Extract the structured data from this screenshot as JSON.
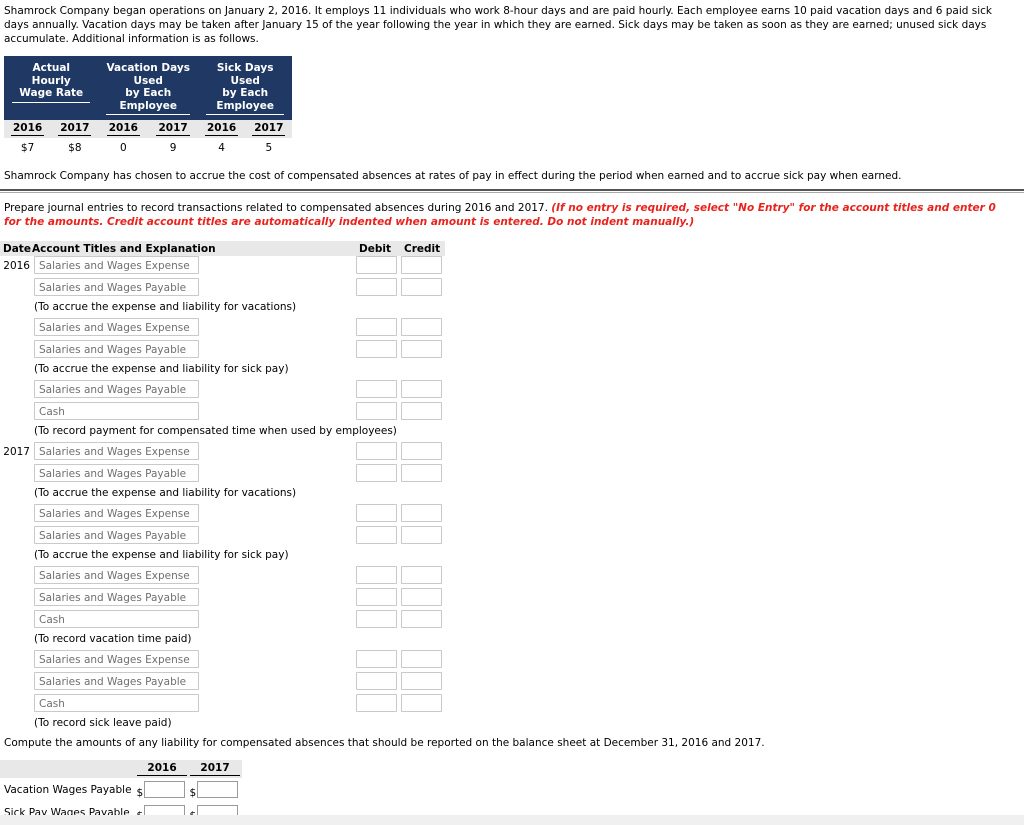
{
  "intro": {
    "paragraph": "Shamrock Company began operations on January 2, 2016. It employs 11 individuals who work 8-hour days and are paid hourly. Each employee earns 10 paid vacation days and 6 paid sick days annually. Vacation days may be taken after January 15 of the year following the year in which they are earned. Sick days may be taken as soon as they are earned; unused sick days accumulate. Additional information is as follows."
  },
  "fact_table": {
    "group_headers": [
      "Actual Hourly Wage Rate",
      "Vacation Days Used by Each Employee",
      "Sick Days Used by Each Employee"
    ],
    "group_header_lines": [
      [
        "Actual",
        "Hourly",
        "Wage Rate"
      ],
      [
        "Vacation Days",
        "Used",
        "by Each",
        "Employee"
      ],
      [
        "Sick Days",
        "Used",
        "by Each",
        "Employee"
      ]
    ],
    "year_headers": [
      "2016",
      "2017",
      "2016",
      "2017",
      "2016",
      "2017"
    ],
    "values": [
      "$7",
      "$8",
      "0",
      "9",
      "4",
      "5"
    ]
  },
  "accrual_note": "Shamrock Company has chosen to accrue the cost of compensated absences at rates of pay in effect during the period when earned and to accrue sick pay when earned.",
  "prompt": {
    "main": "Prepare journal entries to record transactions related to compensated absences during 2016 and 2017. ",
    "italic": "(If no entry is required, select \"No Entry\" for the account titles and enter 0 for the amounts. Credit account titles are automatically indented when amount is entered. Do not indent manually.)"
  },
  "journal": {
    "headers": {
      "date": "Date",
      "account": "Account Titles and Explanation",
      "debit": "Debit",
      "credit": "Credit"
    },
    "rows": [
      {
        "type": "entry",
        "year": "2016",
        "account": "Salaries and Wages Expense"
      },
      {
        "type": "entry",
        "year": "",
        "account": "Salaries and Wages Payable"
      },
      {
        "type": "memo",
        "text": "(To accrue the expense and liability for vacations)"
      },
      {
        "type": "entry",
        "year": "",
        "account": "Salaries and Wages Expense"
      },
      {
        "type": "entry",
        "year": "",
        "account": "Salaries and Wages Payable"
      },
      {
        "type": "memo",
        "text": "(To accrue the expense and liability for sick pay)"
      },
      {
        "type": "entry",
        "year": "",
        "account": "Salaries and Wages Payable"
      },
      {
        "type": "entry",
        "year": "",
        "account": "Cash"
      },
      {
        "type": "memo",
        "text": "(To record payment for compensated time when used by employees)"
      },
      {
        "type": "entry",
        "year": "2017",
        "account": "Salaries and Wages Expense"
      },
      {
        "type": "entry",
        "year": "",
        "account": "Salaries and Wages Payable"
      },
      {
        "type": "memo",
        "text": "(To accrue the expense and liability for vacations)"
      },
      {
        "type": "entry",
        "year": "",
        "account": "Salaries and Wages Expense"
      },
      {
        "type": "entry",
        "year": "",
        "account": "Salaries and Wages Payable"
      },
      {
        "type": "memo",
        "text": "(To accrue the expense and liability for sick pay)"
      },
      {
        "type": "entry",
        "year": "",
        "account": "Salaries and Wages Expense"
      },
      {
        "type": "entry",
        "year": "",
        "account": "Salaries and Wages Payable"
      },
      {
        "type": "entry",
        "year": "",
        "account": "Cash"
      },
      {
        "type": "memo",
        "text": "(To record vacation time paid)"
      },
      {
        "type": "entry",
        "year": "",
        "account": "Salaries and Wages Expense"
      },
      {
        "type": "entry",
        "year": "",
        "account": "Salaries and Wages Payable"
      },
      {
        "type": "entry",
        "year": "",
        "account": "Cash"
      },
      {
        "type": "memo",
        "text": "(To record sick leave paid)"
      }
    ]
  },
  "compute": {
    "text": "Compute the amounts of any liability for compensated absences that should be reported on the balance sheet at December 31, 2016 and 2017.",
    "year_headers": [
      "2016",
      "2017"
    ],
    "rows": [
      {
        "label": "Vacation Wages Payable",
        "values": [
          "",
          ""
        ]
      },
      {
        "label": "Sick Pay Wages Payable",
        "values": [
          "",
          ""
        ]
      }
    ],
    "currency_symbol": "$"
  },
  "colors": {
    "header_navy": "#1F3864",
    "band_gray": "#E8E8E8",
    "accent_red": "#e8231d"
  }
}
